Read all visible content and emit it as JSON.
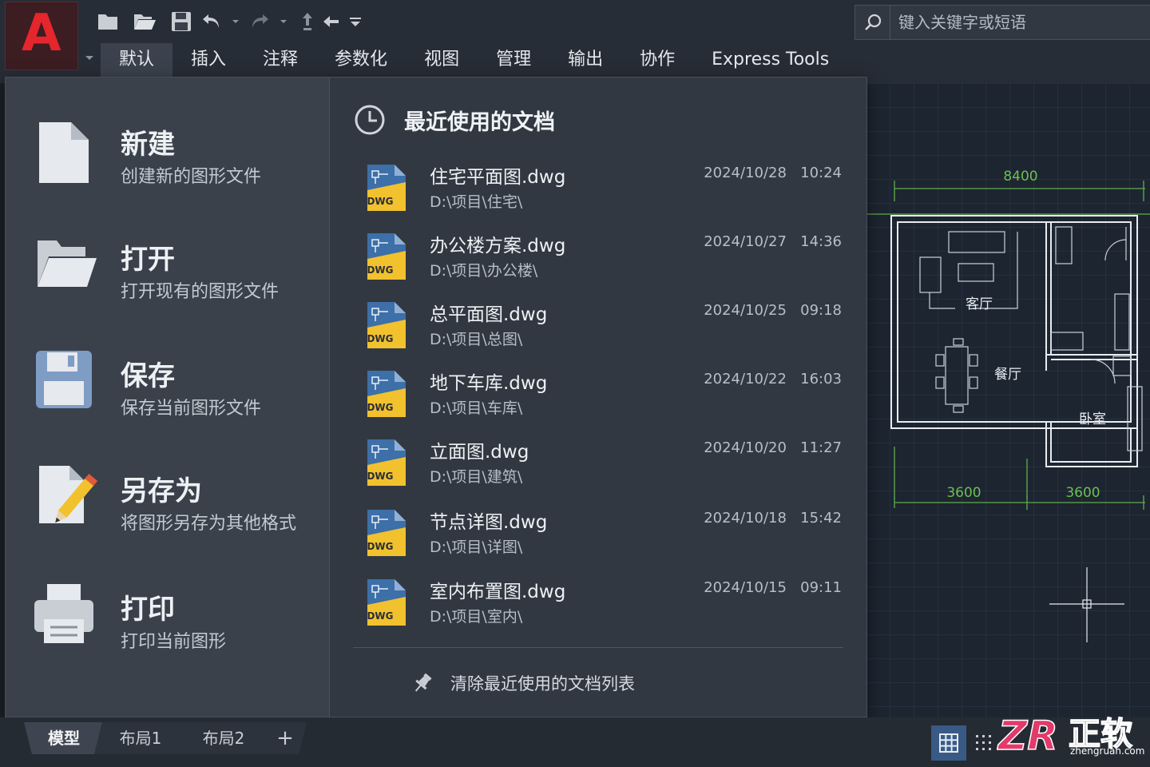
{
  "app": {
    "logo_letter": "A"
  },
  "quick_access": [
    "new-icon",
    "open-icon",
    "save-icon",
    "undo-icon",
    "redo-icon",
    "share-icon",
    "back-icon",
    "customize-icon"
  ],
  "search": {
    "placeholder": "键入关键字或短语"
  },
  "ribbon": {
    "tabs": [
      {
        "label": "默认",
        "active": true
      },
      {
        "label": "插入"
      },
      {
        "label": "注释"
      },
      {
        "label": "参数化"
      },
      {
        "label": "视图"
      },
      {
        "label": "管理"
      },
      {
        "label": "输出"
      },
      {
        "label": "协作"
      },
      {
        "label": "Express Tools"
      }
    ]
  },
  "menu": {
    "commands": [
      {
        "title": "新建",
        "desc": "创建新的图形文件",
        "icon": "new-file-icon"
      },
      {
        "title": "打开",
        "desc": "打开现有的图形文件",
        "icon": "open-folder-icon"
      },
      {
        "title": "保存",
        "desc": "保存当前图形文件",
        "icon": "save-disk-icon"
      },
      {
        "title": "另存为",
        "desc": "将图形另存为其他格式",
        "icon": "save-as-icon"
      },
      {
        "title": "打印",
        "desc": "打印当前图形",
        "icon": "printer-icon"
      }
    ],
    "recent": {
      "title": "最近使用的文档",
      "file_badge": "DWG",
      "items": [
        {
          "name": "住宅平面图.dwg",
          "path": "D:\\项目\\住宅\\",
          "date": "2024/10/28",
          "time": "10:24"
        },
        {
          "name": "办公楼方案.dwg",
          "path": "D:\\项目\\办公楼\\",
          "date": "2024/10/27",
          "time": "14:36"
        },
        {
          "name": "总平面图.dwg",
          "path": "D:\\项目\\总图\\",
          "date": "2024/10/25",
          "time": "09:18"
        },
        {
          "name": "地下车库.dwg",
          "path": "D:\\项目\\车库\\",
          "date": "2024/10/22",
          "time": "16:03"
        },
        {
          "name": "立面图.dwg",
          "path": "D:\\项目\\建筑\\",
          "date": "2024/10/20",
          "time": "11:27"
        },
        {
          "name": "节点详图.dwg",
          "path": "D:\\项目\\详图\\",
          "date": "2024/10/18",
          "time": "15:42"
        },
        {
          "name": "室内布置图.dwg",
          "path": "D:\\项目\\室内\\",
          "date": "2024/10/15",
          "time": "09:11"
        }
      ],
      "clear_label": "清除最近使用的文档列表"
    }
  },
  "drawing": {
    "dimensions": {
      "top": "8400",
      "bottom_left": "3600",
      "bottom_right": "3600"
    },
    "rooms": {
      "living": "客厅",
      "dining": "餐厅",
      "bedroom": "卧室"
    }
  },
  "layout_tabs": [
    {
      "label": "模型",
      "active": true
    },
    {
      "label": "布局1"
    },
    {
      "label": "布局2"
    },
    {
      "label": "+"
    }
  ],
  "watermark": {
    "logo": "ZR",
    "brand": "正软",
    "site": "zhengruan.com"
  },
  "colors": {
    "accent_red": "#e5262c",
    "dwg_yellow": "#f2c12e",
    "cad_green": "#6dbf4f",
    "status_blue": "#3a5a86"
  }
}
